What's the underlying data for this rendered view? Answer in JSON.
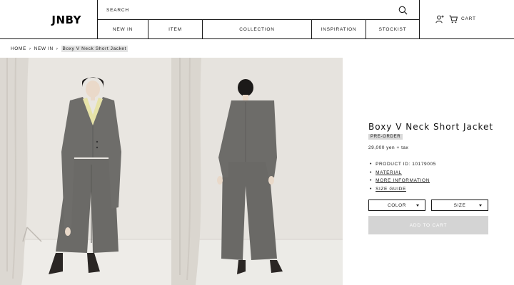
{
  "brand": {
    "logo_text": "JNBY"
  },
  "search": {
    "placeholder": "SEARCH"
  },
  "nav": [
    {
      "label": "NEW IN"
    },
    {
      "label": "ITEM"
    },
    {
      "label": "COLLECTION"
    },
    {
      "label": "INSPIRATION"
    },
    {
      "label": "STOCKIST"
    }
  ],
  "header_right": {
    "cart_label": "CART"
  },
  "breadcrumb": [
    {
      "label": "HOME"
    },
    {
      "label": "NEW IN"
    },
    {
      "label": "Boxy V Neck Short Jacket"
    }
  ],
  "breadcrumb_separator": "›",
  "product": {
    "title": "Boxy V Neck Short Jacket",
    "badge": "PRE-ORDER",
    "price": "29,000 yen + tax",
    "product_id": "PRODUCT ID: 10179005",
    "links": {
      "material": "MATERIAL",
      "more_information": "MORE INFORMATION",
      "size_guide": "SIZE GUIDE"
    },
    "color_select": "COLOR",
    "size_select": "SIZE",
    "add_to_cart": "ADD TO CART"
  },
  "colors": {
    "text": "#1a1a1a",
    "badge_bg": "#d9d9d9",
    "button_disabled": "#d4d4d4",
    "suit_gray": "#6b6a67",
    "photo_bg": "#e7e4df"
  }
}
